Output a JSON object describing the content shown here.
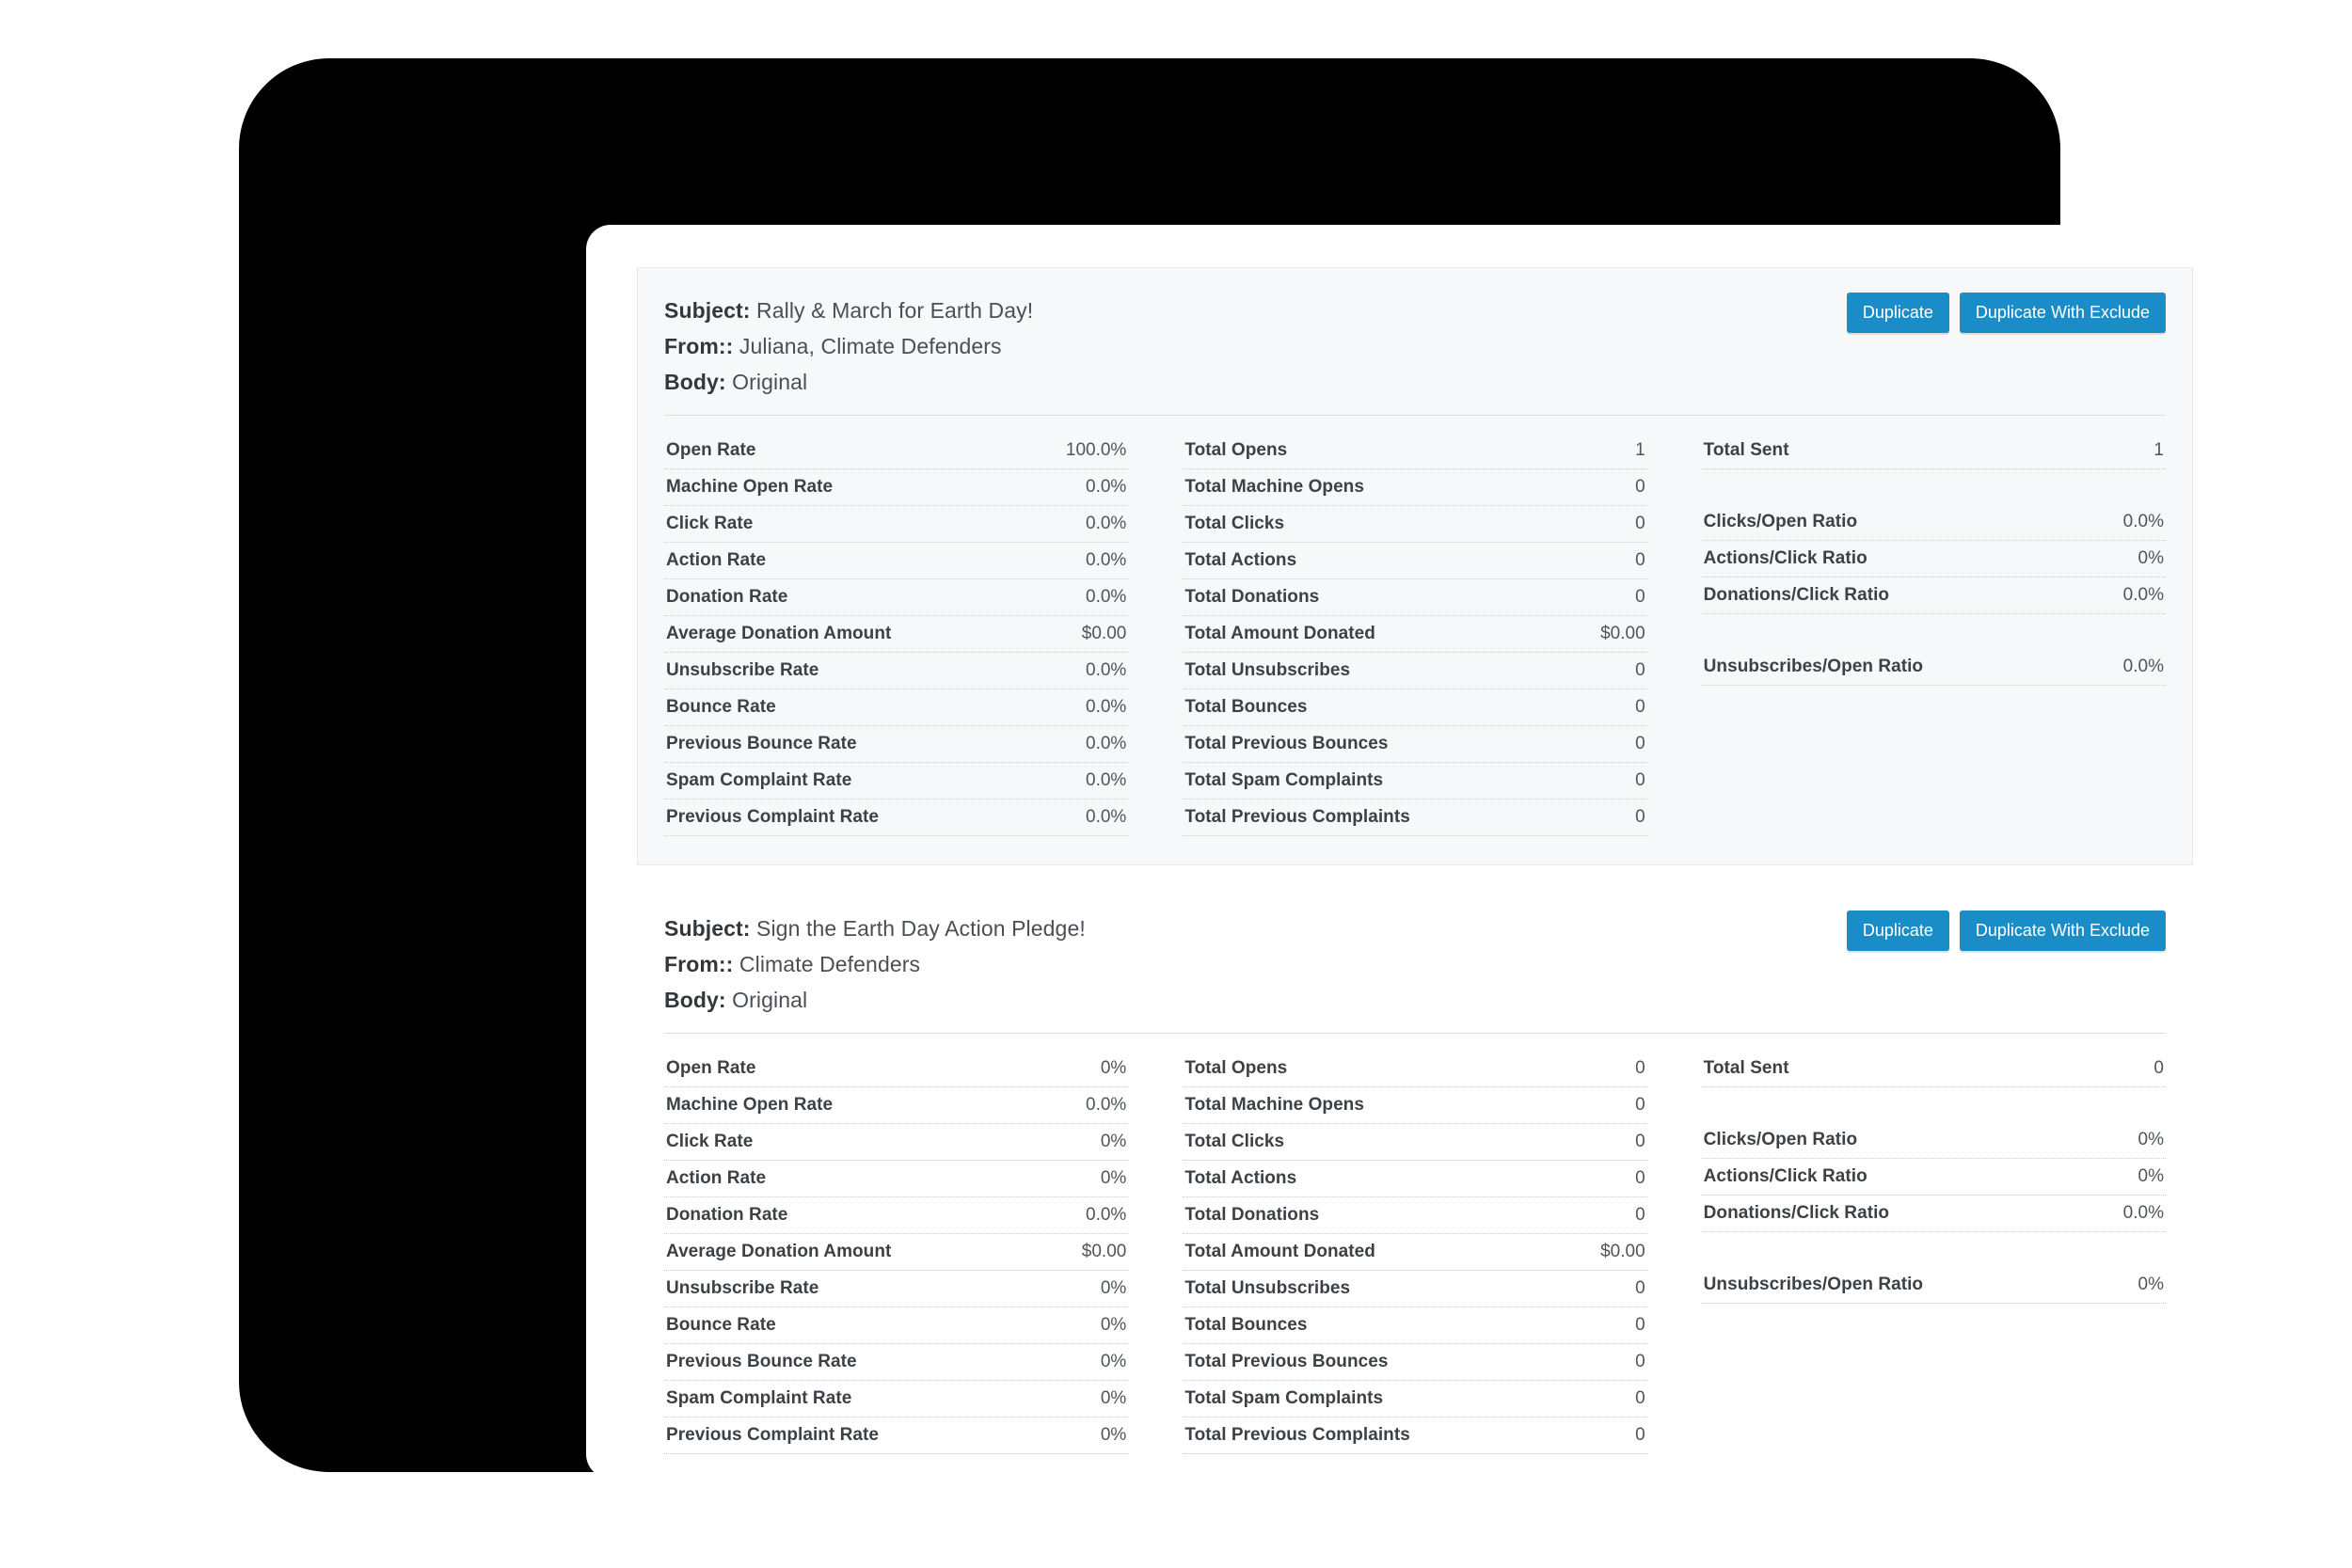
{
  "theme": {
    "accent": "#1a8cc8",
    "bezel": "#000000",
    "screen_bg": "#ffffff",
    "card_bg": "#f7f8fa",
    "card_border": "#e6e8ea",
    "text": "#3c4146",
    "value_text": "#4f5559",
    "divider": "#c9cdd1"
  },
  "panels": [
    {
      "header": {
        "subject_label": "Subject:",
        "subject_value": "Rally & March for Earth Day!",
        "from_label": "From::",
        "from_value": "Juliana, Climate Defenders",
        "body_label": "Body:",
        "body_value": "Original"
      },
      "actions": {
        "duplicate": "Duplicate",
        "duplicate_with_exclude": "Duplicate With Exclude"
      },
      "columns": [
        {
          "rows": [
            {
              "label": "Open Rate",
              "value": "100.0%"
            },
            {
              "label": "Machine Open Rate",
              "value": "0.0%"
            },
            {
              "label": "Click Rate",
              "value": "0.0%"
            },
            {
              "label": "Action Rate",
              "value": "0.0%"
            },
            {
              "label": "Donation Rate",
              "value": "0.0%"
            },
            {
              "label": "Average Donation Amount",
              "value": "$0.00"
            },
            {
              "label": "Unsubscribe Rate",
              "value": "0.0%"
            },
            {
              "label": "Bounce Rate",
              "value": "0.0%"
            },
            {
              "label": "Previous Bounce Rate",
              "value": "0.0%"
            },
            {
              "label": "Spam Complaint Rate",
              "value": "0.0%"
            },
            {
              "label": "Previous Complaint Rate",
              "value": "0.0%"
            }
          ]
        },
        {
          "rows": [
            {
              "label": "Total Opens",
              "value": "1"
            },
            {
              "label": "Total Machine Opens",
              "value": "0"
            },
            {
              "label": "Total Clicks",
              "value": "0"
            },
            {
              "label": "Total Actions",
              "value": "0"
            },
            {
              "label": "Total Donations",
              "value": "0"
            },
            {
              "label": "Total Amount Donated",
              "value": "$0.00"
            },
            {
              "label": "Total Unsubscribes",
              "value": "0"
            },
            {
              "label": "Total Bounces",
              "value": "0"
            },
            {
              "label": "Total Previous Bounces",
              "value": "0"
            },
            {
              "label": "Total Spam Complaints",
              "value": "0"
            },
            {
              "label": "Total Previous Complaints",
              "value": "0"
            }
          ]
        },
        {
          "rows": [
            {
              "label": "Total Sent",
              "value": "1"
            },
            {
              "spacer": true
            },
            {
              "label": "Clicks/Open Ratio",
              "value": "0.0%"
            },
            {
              "label": "Actions/Click Ratio",
              "value": "0%"
            },
            {
              "label": "Donations/Click Ratio",
              "value": "0.0%"
            },
            {
              "spacer": true
            },
            {
              "label": "Unsubscribes/Open Ratio",
              "value": "0.0%"
            }
          ]
        }
      ]
    },
    {
      "header": {
        "subject_label": "Subject:",
        "subject_value": "Sign the Earth Day Action Pledge!",
        "from_label": "From::",
        "from_value": "Climate Defenders",
        "body_label": "Body:",
        "body_value": "Original"
      },
      "actions": {
        "duplicate": "Duplicate",
        "duplicate_with_exclude": "Duplicate With Exclude"
      },
      "columns": [
        {
          "rows": [
            {
              "label": "Open Rate",
              "value": "0%"
            },
            {
              "label": "Machine Open Rate",
              "value": "0.0%"
            },
            {
              "label": "Click Rate",
              "value": "0%"
            },
            {
              "label": "Action Rate",
              "value": "0%"
            },
            {
              "label": "Donation Rate",
              "value": "0.0%"
            },
            {
              "label": "Average Donation Amount",
              "value": "$0.00"
            },
            {
              "label": "Unsubscribe Rate",
              "value": "0%"
            },
            {
              "label": "Bounce Rate",
              "value": "0%"
            },
            {
              "label": "Previous Bounce Rate",
              "value": "0%"
            },
            {
              "label": "Spam Complaint Rate",
              "value": "0%"
            },
            {
              "label": "Previous Complaint Rate",
              "value": "0%"
            }
          ]
        },
        {
          "rows": [
            {
              "label": "Total Opens",
              "value": "0"
            },
            {
              "label": "Total Machine Opens",
              "value": "0"
            },
            {
              "label": "Total Clicks",
              "value": "0"
            },
            {
              "label": "Total Actions",
              "value": "0"
            },
            {
              "label": "Total Donations",
              "value": "0"
            },
            {
              "label": "Total Amount Donated",
              "value": "$0.00"
            },
            {
              "label": "Total Unsubscribes",
              "value": "0"
            },
            {
              "label": "Total Bounces",
              "value": "0"
            },
            {
              "label": "Total Previous Bounces",
              "value": "0"
            },
            {
              "label": "Total Spam Complaints",
              "value": "0"
            },
            {
              "label": "Total Previous Complaints",
              "value": "0"
            }
          ]
        },
        {
          "rows": [
            {
              "label": "Total Sent",
              "value": "0"
            },
            {
              "spacer": true
            },
            {
              "label": "Clicks/Open Ratio",
              "value": "0%"
            },
            {
              "label": "Actions/Click Ratio",
              "value": "0%"
            },
            {
              "label": "Donations/Click Ratio",
              "value": "0.0%"
            },
            {
              "spacer": true
            },
            {
              "label": "Unsubscribes/Open Ratio",
              "value": "0%"
            }
          ]
        }
      ]
    }
  ]
}
